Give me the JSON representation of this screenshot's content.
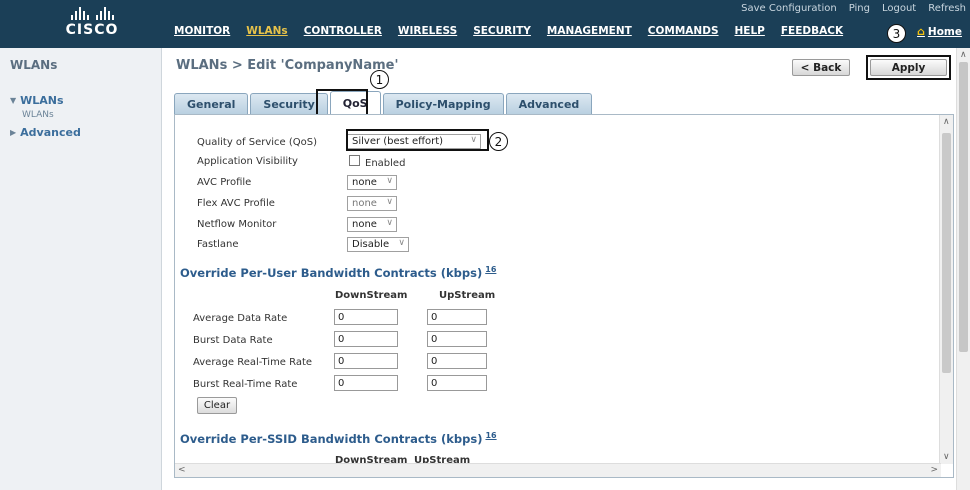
{
  "brand": {
    "name": "CISCO"
  },
  "util_links": [
    "Save Configuration",
    "Ping",
    "Logout",
    "Refresh"
  ],
  "nav": [
    "MONITOR",
    "WLANs",
    "CONTROLLER",
    "WIRELESS",
    "SECURITY",
    "MANAGEMENT",
    "COMMANDS",
    "HELP",
    "FEEDBACK"
  ],
  "nav_active": "WLANs",
  "home_label": "Home",
  "sidebar": {
    "title": "WLANs",
    "group_wlans": "WLANs",
    "sub_wlans": "WLANs",
    "group_advanced": "Advanced"
  },
  "page": {
    "title": "WLANs > Edit  'CompanyName'",
    "back_label": "< Back",
    "apply_label": "Apply"
  },
  "tabs": [
    "General",
    "Security",
    "QoS",
    "Policy-Mapping",
    "Advanced"
  ],
  "active_tab": "QoS",
  "form": {
    "qos_label": "Quality of Service (QoS)",
    "qos_value": "Silver (best effort)",
    "app_visibility_label": "Application Visibility",
    "app_visibility_checkbox": "Enabled",
    "avc_profile_label": "AVC Profile",
    "avc_profile_value": "none",
    "flex_avc_label": "Flex AVC Profile",
    "flex_avc_value": "none",
    "netflow_label": "Netflow Monitor",
    "netflow_value": "none",
    "fastlane_label": "Fastlane",
    "fastlane_value": "Disable"
  },
  "per_user": {
    "title": "Override Per-User Bandwidth Contracts (kbps)",
    "footnote": "16",
    "col_down": "DownStream",
    "col_up": "UpStream",
    "rows": [
      {
        "label": "Average Data Rate",
        "down": "0",
        "up": "0"
      },
      {
        "label": "Burst Data Rate",
        "down": "0",
        "up": "0"
      },
      {
        "label": "Average Real-Time Rate",
        "down": "0",
        "up": "0"
      },
      {
        "label": "Burst Real-Time Rate",
        "down": "0",
        "up": "0"
      }
    ],
    "clear_label": "Clear"
  },
  "per_ssid": {
    "title": "Override Per-SSID Bandwidth Contracts (kbps)",
    "footnote": "16",
    "col_down": "DownStream",
    "col_up": "UpStream"
  },
  "callouts": [
    "1",
    "2",
    "3"
  ]
}
